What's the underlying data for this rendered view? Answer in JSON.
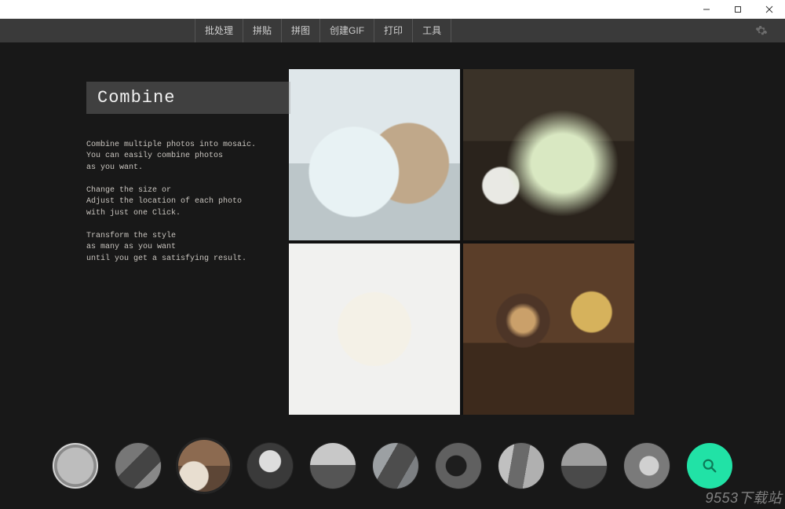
{
  "window": {
    "minimize": "—",
    "maximize": "☐",
    "close": "✕"
  },
  "toolbar": {
    "items": [
      "批处理",
      "拼贴",
      "拼图",
      "创建GIF",
      "打印",
      "工具"
    ]
  },
  "feature": {
    "title": "Combine",
    "desc_line1": "Combine multiple photos into mosaic.",
    "desc_line2": "You can easily combine photos",
    "desc_line3": "as you want.",
    "desc_line4": "Change the size or",
    "desc_line5": "Adjust the location of each photo",
    "desc_line6": "with just one Click.",
    "desc_line7": "Transform the style",
    "desc_line8": "as many as you want",
    "desc_line9": "until you get a satisfying result."
  },
  "thumbnails": {
    "count": 10,
    "active_index": 2
  },
  "watermark": "9553下载站"
}
